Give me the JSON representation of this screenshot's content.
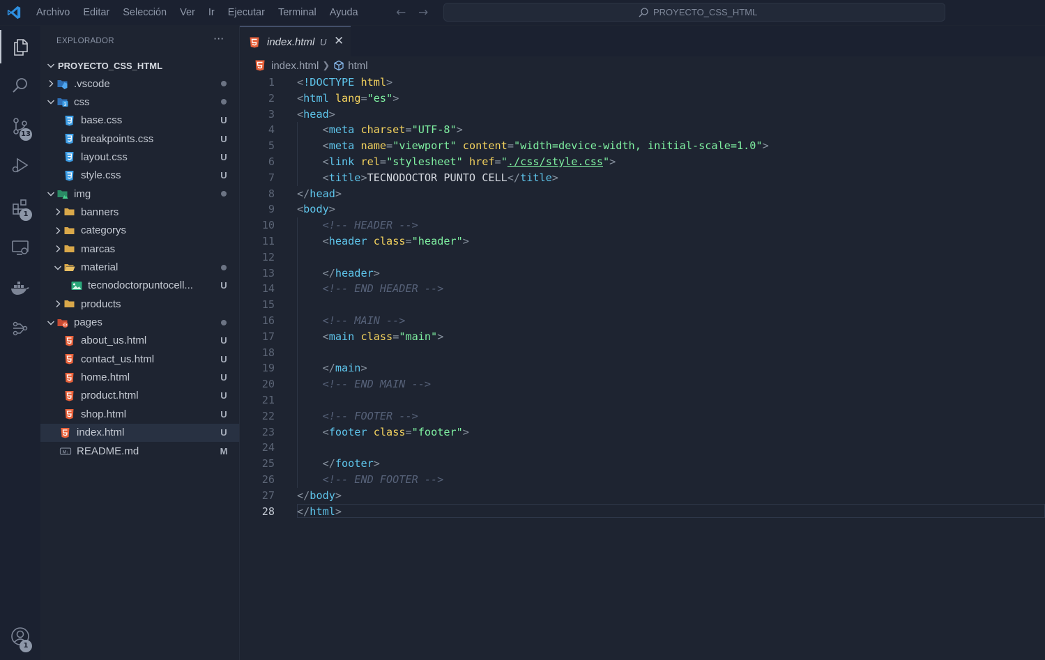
{
  "menu": [
    "Archivo",
    "Editar",
    "Selección",
    "Ver",
    "Ir",
    "Ejecutar",
    "Terminal",
    "Ayuda"
  ],
  "command_center": {
    "text": "PROYECTO_CSS_HTML"
  },
  "activity_bar": {
    "items": [
      {
        "name": "explorer",
        "badge": ""
      },
      {
        "name": "search",
        "badge": ""
      },
      {
        "name": "source-control",
        "badge": "13"
      },
      {
        "name": "run-debug",
        "badge": ""
      },
      {
        "name": "extensions",
        "badge": "1"
      },
      {
        "name": "remote-explorer",
        "badge": ""
      },
      {
        "name": "docker",
        "badge": ""
      },
      {
        "name": "source-graph",
        "badge": ""
      }
    ],
    "accounts_badge": "1"
  },
  "sidebar": {
    "title": "EXPLORADOR",
    "more": "···",
    "root": "PROYECTO_CSS_HTML",
    "tree": [
      {
        "label": ".vscode",
        "indent": 1,
        "type": "folder-vscode",
        "chevron": "right",
        "status": "dot"
      },
      {
        "label": "css",
        "indent": 1,
        "type": "folder-css",
        "chevron": "down",
        "status": "dot"
      },
      {
        "label": "base.css",
        "indent": 2,
        "type": "css",
        "chevron": "",
        "status": "U"
      },
      {
        "label": "breakpoints.css",
        "indent": 2,
        "type": "css",
        "chevron": "",
        "status": "U"
      },
      {
        "label": "layout.css",
        "indent": 2,
        "type": "css",
        "chevron": "",
        "status": "U"
      },
      {
        "label": "style.css",
        "indent": 2,
        "type": "css",
        "chevron": "",
        "status": "U"
      },
      {
        "label": "img",
        "indent": 1,
        "type": "folder-img",
        "chevron": "down",
        "status": "dot"
      },
      {
        "label": "banners",
        "indent": 2,
        "type": "folder",
        "chevron": "right",
        "status": ""
      },
      {
        "label": "categorys",
        "indent": 2,
        "type": "folder",
        "chevron": "right",
        "status": ""
      },
      {
        "label": "marcas",
        "indent": 2,
        "type": "folder",
        "chevron": "right",
        "status": ""
      },
      {
        "label": "material",
        "indent": 2,
        "type": "folder-open",
        "chevron": "down",
        "status": "dot"
      },
      {
        "label": "tecnodoctorpuntocell...",
        "indent": 3,
        "type": "image",
        "chevron": "",
        "status": "U"
      },
      {
        "label": "products",
        "indent": 2,
        "type": "folder",
        "chevron": "right",
        "status": ""
      },
      {
        "label": "pages",
        "indent": 1,
        "type": "folder-pages",
        "chevron": "down",
        "status": "dot"
      },
      {
        "label": "about_us.html",
        "indent": 2,
        "type": "html",
        "chevron": "",
        "status": "U"
      },
      {
        "label": "contact_us.html",
        "indent": 2,
        "type": "html",
        "chevron": "",
        "status": "U"
      },
      {
        "label": "home.html",
        "indent": 2,
        "type": "html",
        "chevron": "",
        "status": "U"
      },
      {
        "label": "product.html",
        "indent": 2,
        "type": "html",
        "chevron": "",
        "status": "U"
      },
      {
        "label": "shop.html",
        "indent": 2,
        "type": "html",
        "chevron": "",
        "status": "U"
      },
      {
        "label": "index.html",
        "indent": 1,
        "type": "html",
        "chevron": "",
        "status": "U",
        "selected": true
      },
      {
        "label": "README.md",
        "indent": 1,
        "type": "md",
        "chevron": "",
        "status": "M"
      }
    ]
  },
  "tab": {
    "label": "index.html",
    "status": "U",
    "close": "✕"
  },
  "breadcrumb": {
    "file": "index.html",
    "symbol": "html"
  },
  "code": {
    "current_line": 28,
    "lines": [
      [
        [
          "p",
          "<"
        ],
        [
          "t",
          "!DOCTYPE"
        ],
        [
          "x",
          " "
        ],
        [
          "a",
          "html"
        ],
        [
          "p",
          ">"
        ]
      ],
      [
        [
          "p",
          "<"
        ],
        [
          "t",
          "html"
        ],
        [
          "x",
          " "
        ],
        [
          "a",
          "lang"
        ],
        [
          "p",
          "="
        ],
        [
          "s",
          "\"es\""
        ],
        [
          "p",
          ">"
        ]
      ],
      [
        [
          "p",
          "<"
        ],
        [
          "t",
          "head"
        ],
        [
          "p",
          ">"
        ]
      ],
      [
        [
          "x",
          "    "
        ],
        [
          "p",
          "<"
        ],
        [
          "t",
          "meta"
        ],
        [
          "x",
          " "
        ],
        [
          "a",
          "charset"
        ],
        [
          "p",
          "="
        ],
        [
          "s",
          "\"UTF-8\""
        ],
        [
          "p",
          ">"
        ]
      ],
      [
        [
          "x",
          "    "
        ],
        [
          "p",
          "<"
        ],
        [
          "t",
          "meta"
        ],
        [
          "x",
          " "
        ],
        [
          "a",
          "name"
        ],
        [
          "p",
          "="
        ],
        [
          "s",
          "\"viewport\""
        ],
        [
          "x",
          " "
        ],
        [
          "a",
          "content"
        ],
        [
          "p",
          "="
        ],
        [
          "s",
          "\"width=device-width, initial-scale=1.0\""
        ],
        [
          "p",
          ">"
        ]
      ],
      [
        [
          "x",
          "    "
        ],
        [
          "p",
          "<"
        ],
        [
          "t",
          "link"
        ],
        [
          "x",
          " "
        ],
        [
          "a",
          "rel"
        ],
        [
          "p",
          "="
        ],
        [
          "s",
          "\"stylesheet\""
        ],
        [
          "x",
          " "
        ],
        [
          "a",
          "href"
        ],
        [
          "p",
          "="
        ],
        [
          "s",
          "\""
        ],
        [
          "su",
          "./css/style.css"
        ],
        [
          "s",
          "\""
        ],
        [
          "p",
          ">"
        ]
      ],
      [
        [
          "x",
          "    "
        ],
        [
          "p",
          "<"
        ],
        [
          "t",
          "title"
        ],
        [
          "p",
          ">"
        ],
        [
          "txt",
          "TECNODOCTOR PUNTO CELL"
        ],
        [
          "p",
          "</"
        ],
        [
          "t",
          "title"
        ],
        [
          "p",
          ">"
        ]
      ],
      [
        [
          "p",
          "</"
        ],
        [
          "t",
          "head"
        ],
        [
          "p",
          ">"
        ]
      ],
      [
        [
          "p",
          "<"
        ],
        [
          "t",
          "body"
        ],
        [
          "p",
          ">"
        ]
      ],
      [
        [
          "x",
          "    "
        ],
        [
          "c",
          "<!-- HEADER -->"
        ]
      ],
      [
        [
          "x",
          "    "
        ],
        [
          "p",
          "<"
        ],
        [
          "t",
          "header"
        ],
        [
          "x",
          " "
        ],
        [
          "a",
          "class"
        ],
        [
          "p",
          "="
        ],
        [
          "s",
          "\"header\""
        ],
        [
          "p",
          ">"
        ]
      ],
      [],
      [
        [
          "x",
          "    "
        ],
        [
          "p",
          "</"
        ],
        [
          "t",
          "header"
        ],
        [
          "p",
          ">"
        ]
      ],
      [
        [
          "x",
          "    "
        ],
        [
          "c",
          "<!-- END HEADER -->"
        ]
      ],
      [],
      [
        [
          "x",
          "    "
        ],
        [
          "c",
          "<!-- MAIN -->"
        ]
      ],
      [
        [
          "x",
          "    "
        ],
        [
          "p",
          "<"
        ],
        [
          "t",
          "main"
        ],
        [
          "x",
          " "
        ],
        [
          "a",
          "class"
        ],
        [
          "p",
          "="
        ],
        [
          "s",
          "\"main\""
        ],
        [
          "p",
          ">"
        ]
      ],
      [],
      [
        [
          "x",
          "    "
        ],
        [
          "p",
          "</"
        ],
        [
          "t",
          "main"
        ],
        [
          "p",
          ">"
        ]
      ],
      [
        [
          "x",
          "    "
        ],
        [
          "c",
          "<!-- END MAIN -->"
        ]
      ],
      [],
      [
        [
          "x",
          "    "
        ],
        [
          "c",
          "<!-- FOOTER -->"
        ]
      ],
      [
        [
          "x",
          "    "
        ],
        [
          "p",
          "<"
        ],
        [
          "t",
          "footer"
        ],
        [
          "x",
          " "
        ],
        [
          "a",
          "class"
        ],
        [
          "p",
          "="
        ],
        [
          "s",
          "\"footer\""
        ],
        [
          "p",
          ">"
        ]
      ],
      [],
      [
        [
          "x",
          "    "
        ],
        [
          "p",
          "</"
        ],
        [
          "t",
          "footer"
        ],
        [
          "p",
          ">"
        ]
      ],
      [
        [
          "x",
          "    "
        ],
        [
          "c",
          "<!-- END FOOTER -->"
        ]
      ],
      [
        [
          "p",
          "</"
        ],
        [
          "t",
          "body"
        ],
        [
          "p",
          ">"
        ]
      ],
      [
        [
          "p",
          "</"
        ],
        [
          "t",
          "html"
        ],
        [
          "p",
          ">"
        ]
      ]
    ]
  },
  "colors": {
    "tag": "#5ec4ea",
    "attr": "#f4d35e",
    "string": "#7ff0a1",
    "comment": "#566178",
    "html_icon": "#e8613a",
    "css_icon": "#3d9ee6",
    "folder": "#d9a84a"
  }
}
